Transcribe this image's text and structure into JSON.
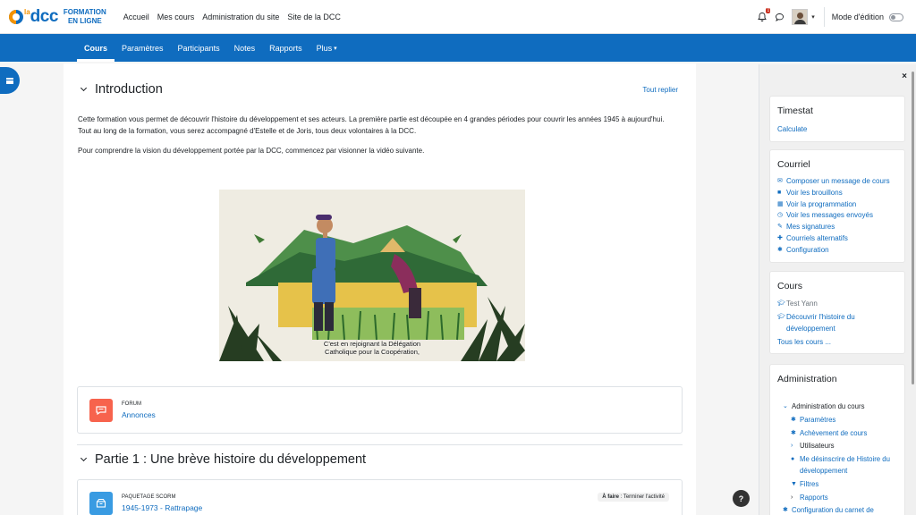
{
  "brand": {
    "small": "la",
    "big": "dcc",
    "line1": "FORMATION",
    "line2": "EN LIGNE"
  },
  "topnav": [
    "Accueil",
    "Mes cours",
    "Administration du site",
    "Site de la DCC"
  ],
  "notifications": {
    "count": "1"
  },
  "mode_edition": "Mode d'édition",
  "secnav": [
    "Cours",
    "Paramètres",
    "Participants",
    "Notes",
    "Rapports",
    "Plus"
  ],
  "secnav_more_caret": "⌄",
  "intro": {
    "title": "Introduction",
    "collapse_all": "Tout replier",
    "para1": "Cette formation vous permet de découvrir l'histoire du développement et ses acteurs. La première partie est découpée en 4 grandes périodes pour couvrir les années 1945 à aujourd'hui. Tout au long de la formation, vous serez accompagné d'Estelle et de Joris, tous deux volontaires à la DCC.",
    "para2": "Pour comprendre la vision du développement portée par la DCC, commencez par visionner la vidéo suivante.",
    "video_caption_1": "C'est en rejoignant la Délégation",
    "video_caption_2": "Catholique pour la Coopération,"
  },
  "forum": {
    "type": "FORUM",
    "name": "Annonces",
    "color": "#f7634d"
  },
  "part1": {
    "title": "Partie 1 : Une brève histoire du développement"
  },
  "scorm": {
    "type": "PAQUETAGE SCORM",
    "name": "1945-1973 - Rattrapage",
    "todo_label": "À faire",
    "todo_text": " : Terminer l'activité",
    "color": "#399be2"
  },
  "blocks": {
    "timestat": {
      "title": "Timestat",
      "link": "Calculate"
    },
    "courriel": {
      "title": "Courriel",
      "items": [
        {
          "icon": "envelope-icon",
          "label": "Composer un message de cours"
        },
        {
          "icon": "file-icon",
          "label": "Voir les brouillons"
        },
        {
          "icon": "calendar-icon",
          "label": "Voir la programmation"
        },
        {
          "icon": "send-icon",
          "label": "Voir les messages envoyés"
        },
        {
          "icon": "pen-icon",
          "label": "Mes signatures"
        },
        {
          "icon": "plus-icon",
          "label": "Courriels alternatifs"
        },
        {
          "icon": "gear-icon",
          "label": "Configuration"
        }
      ]
    },
    "cours": {
      "title": "Cours",
      "items": [
        {
          "label": "Test Yann"
        },
        {
          "label": "Découvrir l'histoire du développement"
        },
        {
          "label": "Tous les cours ..."
        }
      ]
    },
    "administration": {
      "title": "Administration",
      "items": [
        {
          "label": "Administration du cours"
        },
        {
          "label": "Paramètres"
        },
        {
          "label": "Achèvement de cours"
        },
        {
          "label": "Utilisateurs"
        },
        {
          "label": "Me désinscrire de Histoire du développement"
        },
        {
          "label": "Filtres"
        },
        {
          "label": "Rapports"
        },
        {
          "label": "Configuration du carnet de"
        }
      ]
    }
  },
  "close_label": "×",
  "help_label": "?"
}
